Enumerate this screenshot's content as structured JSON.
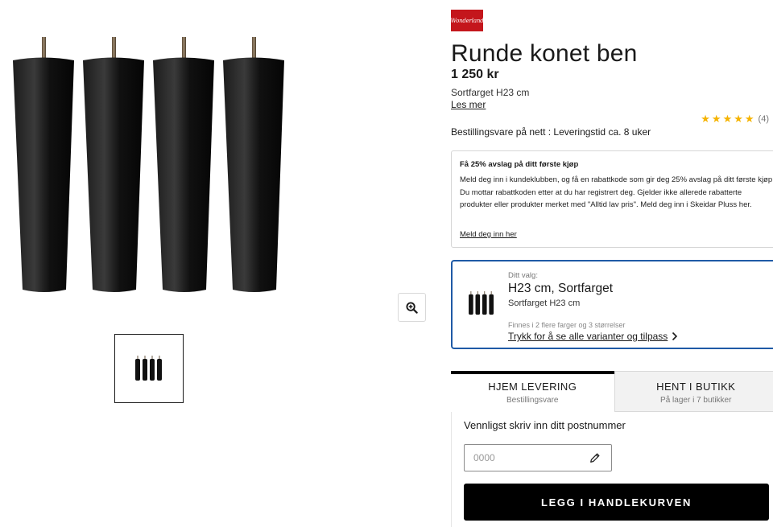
{
  "brand": {
    "logo_text": "Wonderland",
    "accent": "#c4161c"
  },
  "product": {
    "title": "Runde konet ben",
    "price": "1 250 kr",
    "variant": "Sortfarget H23 cm",
    "read_more": "Les mer",
    "rating": {
      "stars": 5,
      "count": "(4)"
    },
    "availability": "Bestillingsvare på nett : Leveringstid ca. 8 uker"
  },
  "promo": {
    "title": "Få 25% avslag på ditt første kjøp",
    "body": "Meld deg inn i kundeklubben, og få en rabattkode som gir deg 25% avslag på ditt første kjøp. Du mottar rabattkoden etter at du har registrert deg. Gjelder ikke allerede rabatterte produkter eller produkter merket med \"Alltid lav pris\". Meld deg inn i Skeidar Pluss her.",
    "link": "Meld deg inn her"
  },
  "choice": {
    "label": "Ditt valg:",
    "value": "H23 cm, Sortfarget",
    "sub": "Sortfarget H23 cm",
    "note": "Finnes i 2 flere farger og 3 størrelser",
    "link": "Trykk for å se alle varianter og tilpass"
  },
  "delivery_tabs": [
    {
      "title": "HJEM LEVERING",
      "sub": "Bestillingsvare",
      "active": true
    },
    {
      "title": "HENT I BUTIKK",
      "sub": "På lager i 7 butikker",
      "active": false
    }
  ],
  "postal": {
    "label": "Vennligst skriv inn ditt postnummer",
    "placeholder": "0000",
    "value": ""
  },
  "add_to_cart": "LEGG I HANDLEKURVEN",
  "icons": {
    "zoom": "zoom-in-icon",
    "pencil": "pencil-icon",
    "chevron": "chevron-right-icon",
    "star": "star-icon"
  },
  "colors": {
    "star": "#f5b301",
    "choice_border": "#1f5aa6",
    "button": "#000000"
  }
}
